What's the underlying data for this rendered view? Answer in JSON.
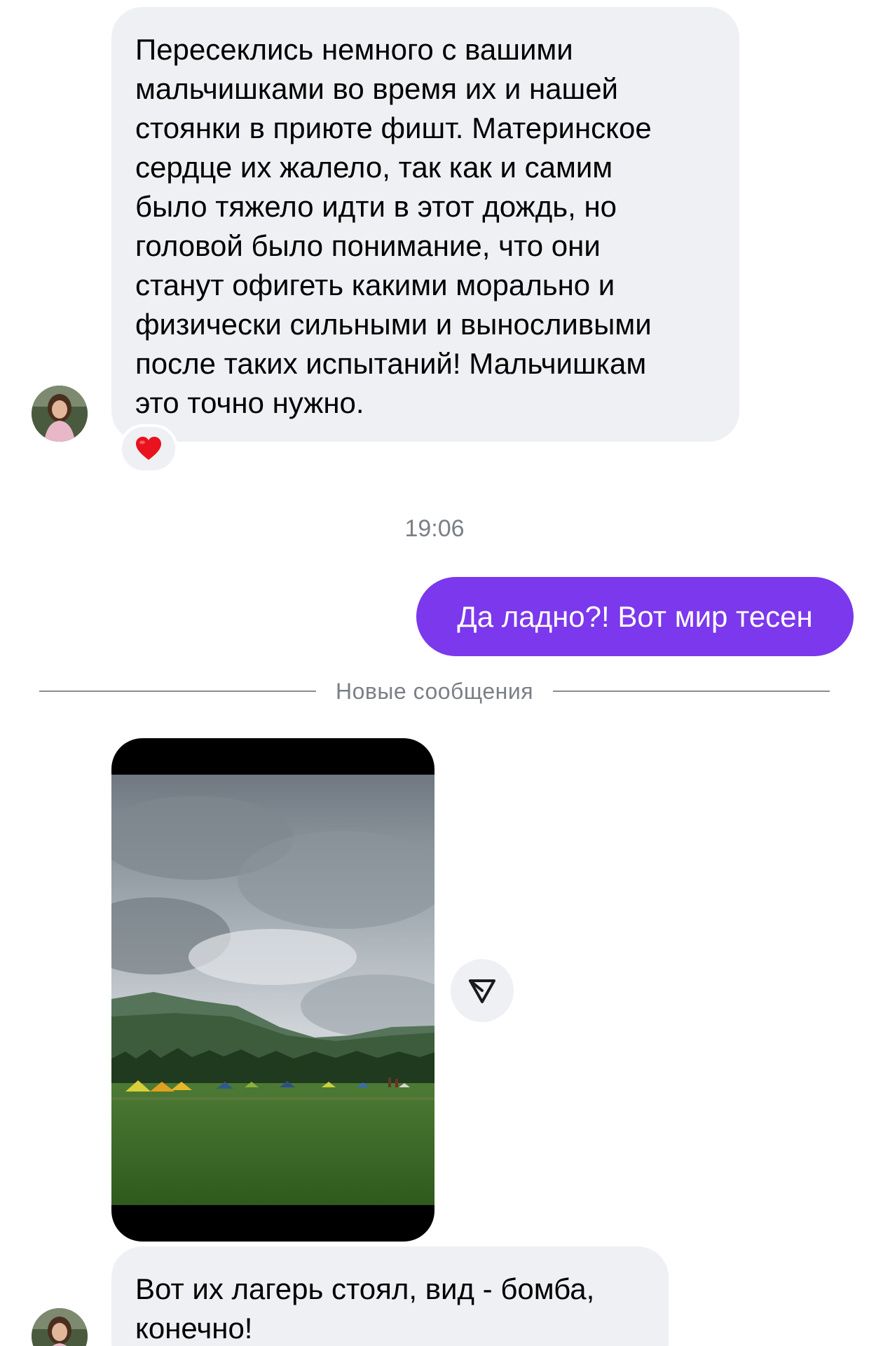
{
  "conversation": {
    "message_1": {
      "text": "Пересеклись немного с вашими\nмальчишками во время их и нашей\nстоянки в приюте фишт. Материнское\nсердце их жалело, так как и самим\nбыло тяжело идти в этот дождь, но\nголовой было понимание, что они\nстанут офигеть какими морально и\nфизически сильными и выносливыми\nпосле таких испытаний! Мальчишкам\nэто точно нужно.",
      "reaction_icon": "red-heart-icon"
    },
    "timestamp": "19:06",
    "message_2_outgoing": {
      "text": "Да ладно?! Вот мир тесен"
    },
    "new_messages_divider": "Новые сообщения",
    "media_message": {
      "icon": "share-icon",
      "colors": {
        "sky": "#9aa3ab",
        "grass": "#3f6b2a"
      }
    },
    "message_3": {
      "text": "Вот их лагерь стоял, вид - бомба,\nконечно!"
    }
  },
  "theme": {
    "incoming_bubble": "#eff0f3",
    "outgoing_bubble": "#7b38ec",
    "muted_text": "#7b7f86"
  }
}
